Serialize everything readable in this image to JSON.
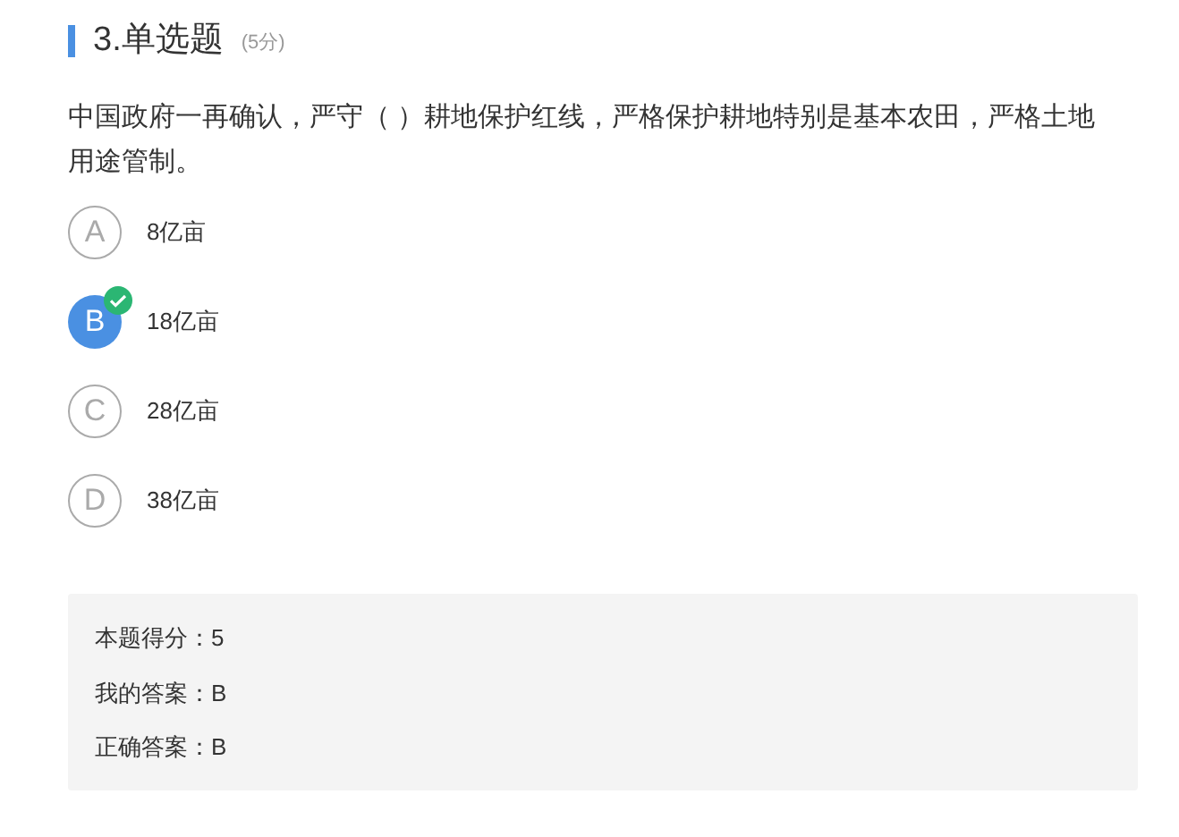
{
  "question": {
    "title": "3.单选题",
    "points": "(5分)",
    "text": "中国政府一再确认，严守（ ）耕地保护红线，严格保护耕地特别是基本农田，严格土地用途管制。"
  },
  "options": [
    {
      "letter": "A",
      "text": "8亿亩",
      "selected": false
    },
    {
      "letter": "B",
      "text": "18亿亩",
      "selected": true
    },
    {
      "letter": "C",
      "text": "28亿亩",
      "selected": false
    },
    {
      "letter": "D",
      "text": "38亿亩",
      "selected": false
    }
  ],
  "result": [
    "本题得分：5",
    "我的答案：B",
    "正确答案：B"
  ]
}
